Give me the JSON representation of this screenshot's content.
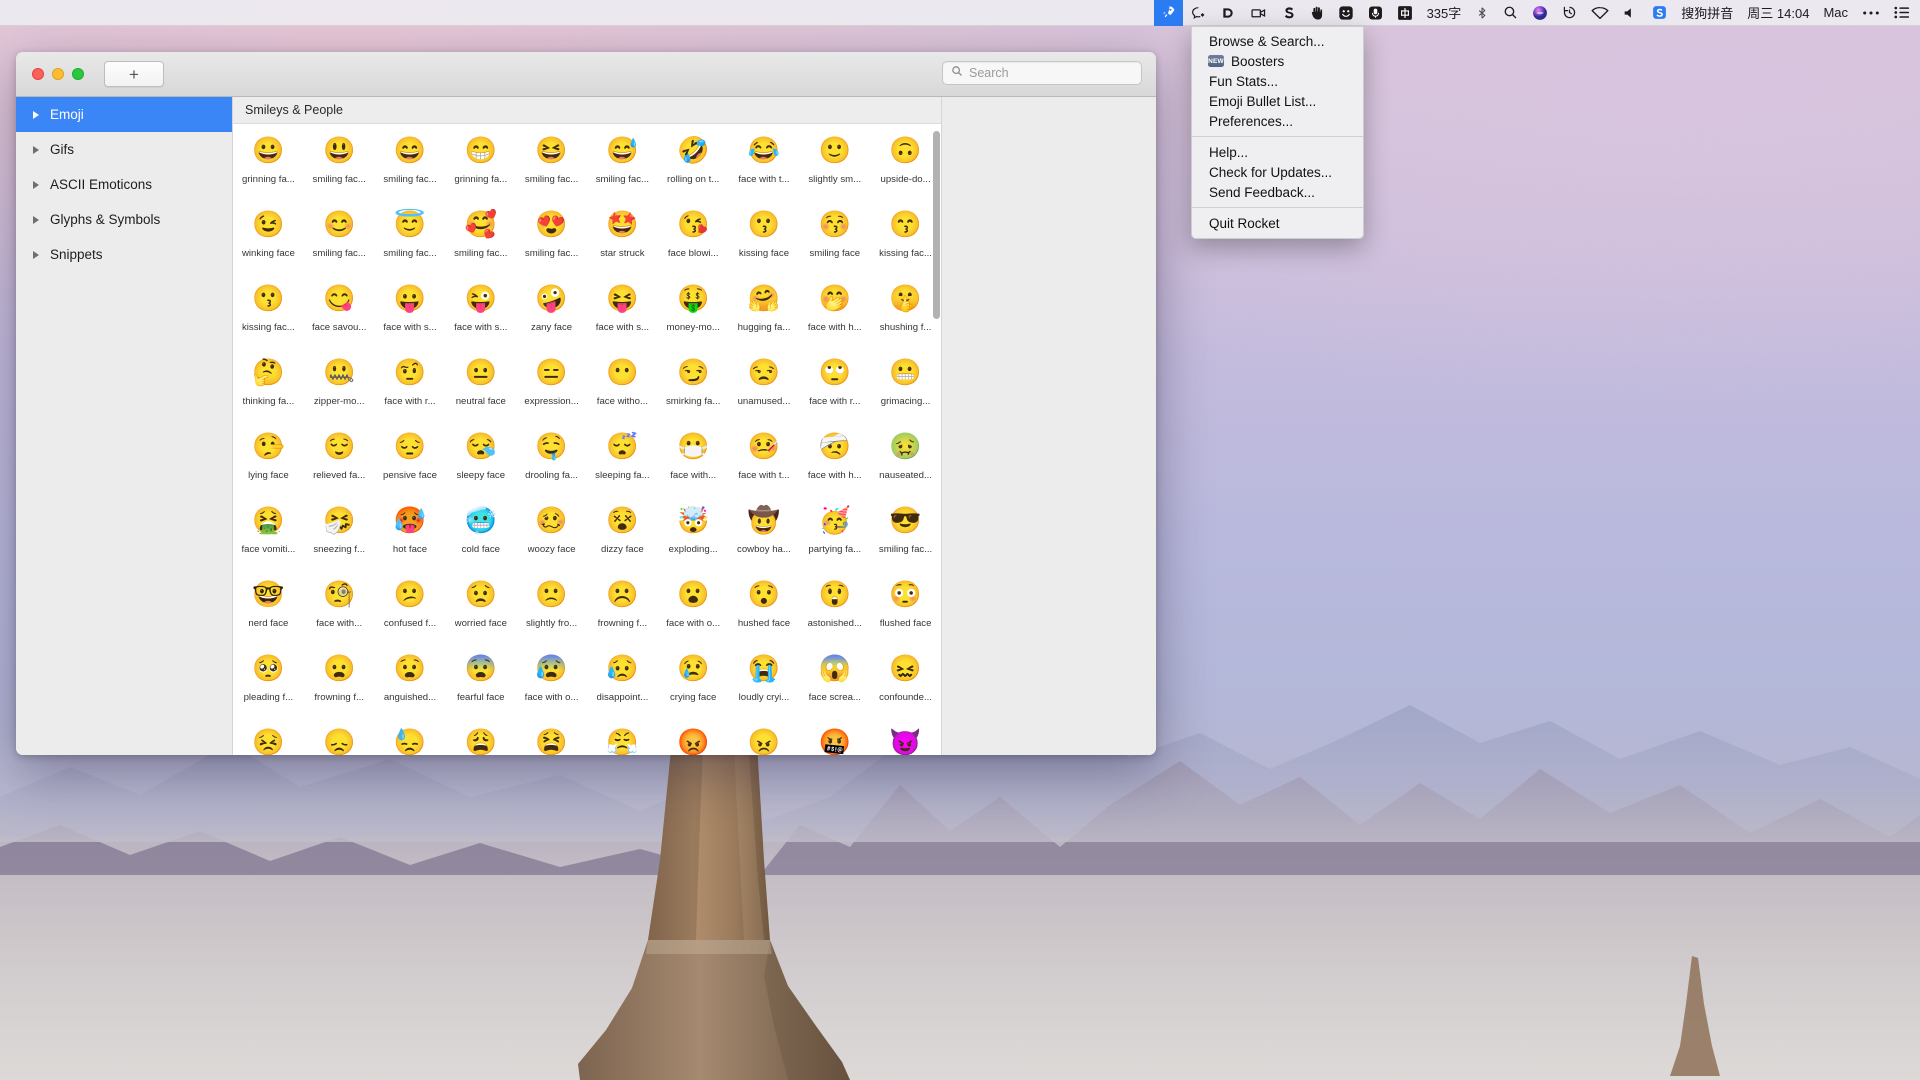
{
  "menubar": {
    "left_icons": [],
    "status_items": [
      {
        "name": "rocket-icon",
        "glyph": "rocket",
        "active": true
      },
      {
        "name": "speech-bubble-icon",
        "glyph": "bubble",
        "active": false
      },
      {
        "name": "dropbox-icon",
        "glyph": "dbox",
        "active": false
      },
      {
        "name": "video-camera-icon",
        "glyph": "camcorder",
        "active": false
      },
      {
        "name": "sketch-icon",
        "glyph": "sketch",
        "active": false
      },
      {
        "name": "hand-icon",
        "glyph": "hand",
        "active": false
      },
      {
        "name": "smiley-icon",
        "glyph": "smiley",
        "active": false
      },
      {
        "name": "microphone-icon",
        "glyph": "mic",
        "active": false
      },
      {
        "name": "chinese-input-icon",
        "glyph": "zhong",
        "active": false
      }
    ],
    "word_count": "335字",
    "bluetooth_label": "",
    "input_method": "搜狗拼音",
    "clock": "周三 14:04",
    "user": "Mac"
  },
  "menu": {
    "items": [
      {
        "label": "Browse & Search...",
        "badge": null
      },
      {
        "label": "Boosters",
        "badge": "NEW"
      },
      {
        "label": "Fun Stats...",
        "badge": null
      },
      {
        "label": "Emoji Bullet List...",
        "badge": null
      },
      {
        "label": "Preferences...",
        "badge": null
      },
      {
        "separator": true
      },
      {
        "label": "Help...",
        "badge": null
      },
      {
        "label": "Check for Updates...",
        "badge": null
      },
      {
        "label": "Send Feedback...",
        "badge": null
      },
      {
        "separator": true
      },
      {
        "label": "Quit Rocket",
        "badge": null
      }
    ]
  },
  "window": {
    "new_tab_label": "+",
    "search": {
      "placeholder": "Search",
      "value": ""
    },
    "sidebar": {
      "items": [
        {
          "label": "Emoji",
          "selected": true
        },
        {
          "label": "Gifs",
          "selected": false
        },
        {
          "label": "ASCII Emoticons",
          "selected": false
        },
        {
          "label": "Glyphs & Symbols",
          "selected": false
        },
        {
          "label": "Snippets",
          "selected": false
        }
      ]
    },
    "category_header": "Smileys & People",
    "emoji_rows": [
      [
        {
          "glyph": "😀",
          "label": "grinning fa..."
        },
        {
          "glyph": "😃",
          "label": "smiling fac..."
        },
        {
          "glyph": "😄",
          "label": "smiling fac..."
        },
        {
          "glyph": "😁",
          "label": "grinning fa..."
        },
        {
          "glyph": "😆",
          "label": "smiling fac..."
        },
        {
          "glyph": "😅",
          "label": "smiling fac..."
        },
        {
          "glyph": "🤣",
          "label": "rolling on t..."
        },
        {
          "glyph": "😂",
          "label": "face with t..."
        },
        {
          "glyph": "🙂",
          "label": "slightly sm..."
        },
        {
          "glyph": "🙃",
          "label": "upside-do..."
        }
      ],
      [
        {
          "glyph": "😉",
          "label": "winking face"
        },
        {
          "glyph": "😊",
          "label": "smiling fac..."
        },
        {
          "glyph": "😇",
          "label": "smiling fac..."
        },
        {
          "glyph": "🥰",
          "label": "smiling fac..."
        },
        {
          "glyph": "😍",
          "label": "smiling fac..."
        },
        {
          "glyph": "🤩",
          "label": "star struck"
        },
        {
          "glyph": "😘",
          "label": "face blowi..."
        },
        {
          "glyph": "😗",
          "label": "kissing face"
        },
        {
          "glyph": "😚",
          "label": "smiling face"
        },
        {
          "glyph": "😙",
          "label": "kissing fac..."
        }
      ],
      [
        {
          "glyph": "😗",
          "label": "kissing fac..."
        },
        {
          "glyph": "😋",
          "label": "face savou..."
        },
        {
          "glyph": "😛",
          "label": "face with s..."
        },
        {
          "glyph": "😜",
          "label": "face with s..."
        },
        {
          "glyph": "🤪",
          "label": "zany face"
        },
        {
          "glyph": "😝",
          "label": "face with s..."
        },
        {
          "glyph": "🤑",
          "label": "money-mo..."
        },
        {
          "glyph": "🤗",
          "label": "hugging fa..."
        },
        {
          "glyph": "🤭",
          "label": "face with h..."
        },
        {
          "glyph": "🤫",
          "label": "shushing f..."
        }
      ],
      [
        {
          "glyph": "🤔",
          "label": "thinking fa..."
        },
        {
          "glyph": "🤐",
          "label": "zipper-mo..."
        },
        {
          "glyph": "🤨",
          "label": "face with r..."
        },
        {
          "glyph": "😐",
          "label": "neutral face"
        },
        {
          "glyph": "😑",
          "label": "expression..."
        },
        {
          "glyph": "😶",
          "label": "face witho..."
        },
        {
          "glyph": "😏",
          "label": "smirking fa..."
        },
        {
          "glyph": "😒",
          "label": "unamused..."
        },
        {
          "glyph": "🙄",
          "label": "face with r..."
        },
        {
          "glyph": "😬",
          "label": "grimacing..."
        }
      ],
      [
        {
          "glyph": "🤥",
          "label": "lying face"
        },
        {
          "glyph": "😌",
          "label": "relieved fa..."
        },
        {
          "glyph": "😔",
          "label": "pensive face"
        },
        {
          "glyph": "😪",
          "label": "sleepy face"
        },
        {
          "glyph": "🤤",
          "label": "drooling fa..."
        },
        {
          "glyph": "😴",
          "label": "sleeping fa..."
        },
        {
          "glyph": "😷",
          "label": "face with..."
        },
        {
          "glyph": "🤒",
          "label": "face with t..."
        },
        {
          "glyph": "🤕",
          "label": "face with h..."
        },
        {
          "glyph": "🤢",
          "label": "nauseated..."
        }
      ],
      [
        {
          "glyph": "🤮",
          "label": "face vomiti..."
        },
        {
          "glyph": "🤧",
          "label": "sneezing f..."
        },
        {
          "glyph": "🥵",
          "label": "hot face"
        },
        {
          "glyph": "🥶",
          "label": "cold face"
        },
        {
          "glyph": "🥴",
          "label": "woozy face"
        },
        {
          "glyph": "😵",
          "label": "dizzy face"
        },
        {
          "glyph": "🤯",
          "label": "exploding..."
        },
        {
          "glyph": "🤠",
          "label": "cowboy ha..."
        },
        {
          "glyph": "🥳",
          "label": "partying fa..."
        },
        {
          "glyph": "😎",
          "label": "smiling fac..."
        }
      ],
      [
        {
          "glyph": "🤓",
          "label": "nerd face"
        },
        {
          "glyph": "🧐",
          "label": "face with..."
        },
        {
          "glyph": "😕",
          "label": "confused f..."
        },
        {
          "glyph": "😟",
          "label": "worried face"
        },
        {
          "glyph": "🙁",
          "label": "slightly fro..."
        },
        {
          "glyph": "☹️",
          "label": "frowning f..."
        },
        {
          "glyph": "😮",
          "label": "face with o..."
        },
        {
          "glyph": "😯",
          "label": "hushed face"
        },
        {
          "glyph": "😲",
          "label": "astonished..."
        },
        {
          "glyph": "😳",
          "label": "flushed face"
        }
      ],
      [
        {
          "glyph": "🥺",
          "label": "pleading f..."
        },
        {
          "glyph": "😦",
          "label": "frowning f..."
        },
        {
          "glyph": "😧",
          "label": "anguished..."
        },
        {
          "glyph": "😨",
          "label": "fearful face"
        },
        {
          "glyph": "😰",
          "label": "face with o..."
        },
        {
          "glyph": "😥",
          "label": "disappoint..."
        },
        {
          "glyph": "😢",
          "label": "crying face"
        },
        {
          "glyph": "😭",
          "label": "loudly cryi..."
        },
        {
          "glyph": "😱",
          "label": "face screa..."
        },
        {
          "glyph": "😖",
          "label": "confounde..."
        }
      ],
      [
        {
          "glyph": "😣",
          "label": ""
        },
        {
          "glyph": "😞",
          "label": ""
        },
        {
          "glyph": "😓",
          "label": ""
        },
        {
          "glyph": "😩",
          "label": ""
        },
        {
          "glyph": "😫",
          "label": ""
        },
        {
          "glyph": "😤",
          "label": ""
        },
        {
          "glyph": "😡",
          "label": ""
        },
        {
          "glyph": "😠",
          "label": ""
        },
        {
          "glyph": "🤬",
          "label": ""
        },
        {
          "glyph": "😈",
          "label": ""
        }
      ]
    ]
  },
  "colors": {
    "accent": "#3b86f7",
    "menubar_active": "#2b7bf3",
    "window_bg": "#ececec",
    "grid_bg": "#ffffff"
  }
}
